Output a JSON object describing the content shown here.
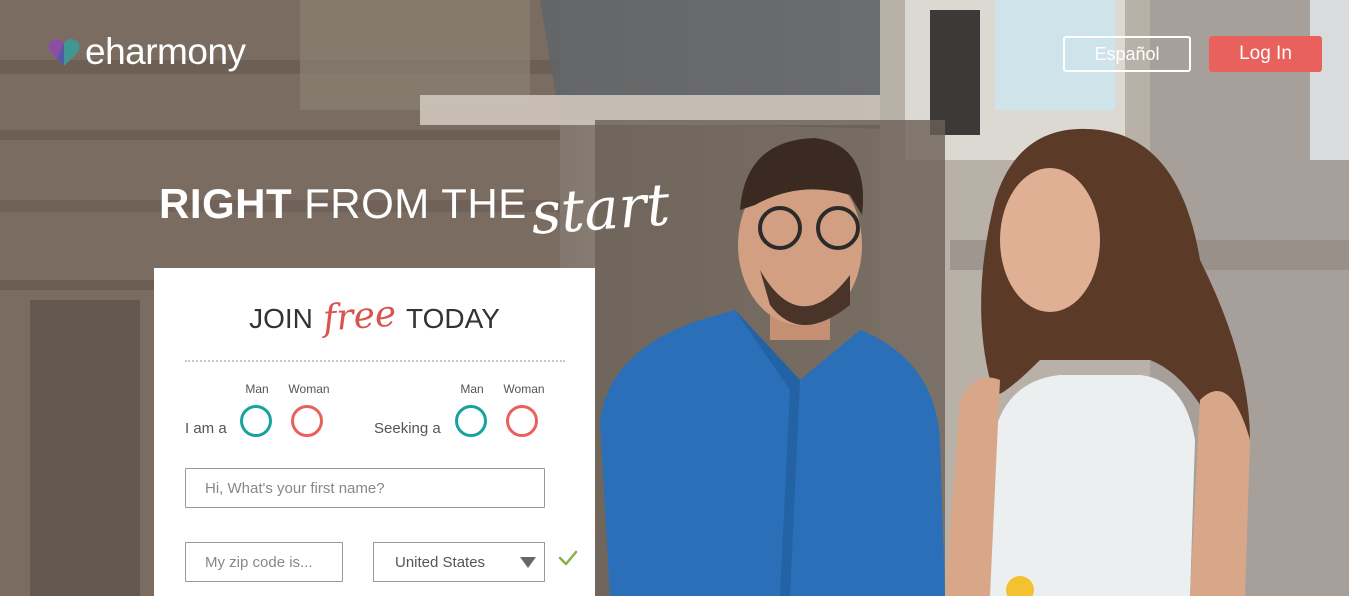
{
  "brand": {
    "name": "eharmony"
  },
  "header": {
    "language_label": "Español",
    "login_label": "Log In"
  },
  "hero": {
    "tagline_strong": "RIGHT",
    "tagline_light": "FROM THE",
    "tagline_script": "start"
  },
  "signup": {
    "title_before": "JOIN",
    "title_script": "free",
    "title_after": "TODAY",
    "i_am": {
      "label": "I am a",
      "options": [
        "Man",
        "Woman"
      ]
    },
    "seeking": {
      "label": "Seeking a",
      "options": [
        "Man",
        "Woman"
      ]
    },
    "first_name": {
      "placeholder": "Hi, What's your first name?",
      "value": ""
    },
    "zip": {
      "placeholder": "My zip code is...",
      "value": ""
    },
    "country": {
      "selected": "United States"
    }
  },
  "colors": {
    "accent": "#e8615d",
    "teal": "#17a2a0",
    "check_green": "#8bb04a"
  },
  "icons": [
    "eharmony-heart-logo-icon",
    "chevron-down-icon",
    "checkmark-icon"
  ]
}
